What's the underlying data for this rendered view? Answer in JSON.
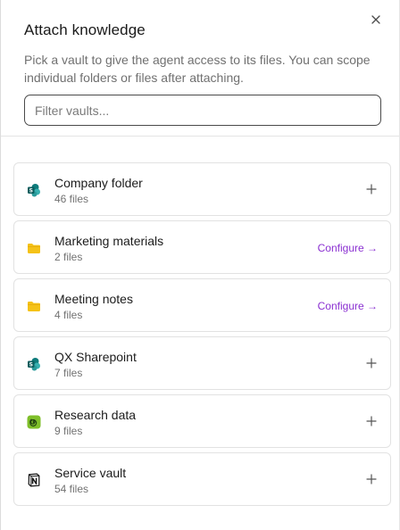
{
  "dialog": {
    "title": "Attach knowledge",
    "subtitle": "Pick a vault to give the agent access to its files. You can scope individual folders or files after attaching.",
    "filter_placeholder": "Filter vaults..."
  },
  "vaults": [
    {
      "name": "Company folder",
      "count": "46 files",
      "icon": "sharepoint-icon",
      "action": "add"
    },
    {
      "name": "Marketing materials",
      "count": "2 files",
      "icon": "folder-icon",
      "action": "configure",
      "action_label": "Configure →"
    },
    {
      "name": "Meeting notes",
      "count": "4 files",
      "icon": "folder-icon",
      "action": "configure",
      "action_label": "Configure →"
    },
    {
      "name": "QX Sharepoint",
      "count": "7 files",
      "icon": "sharepoint-icon",
      "action": "add"
    },
    {
      "name": "Research data",
      "count": "9 files",
      "icon": "spiral-icon",
      "action": "add"
    },
    {
      "name": "Service vault",
      "count": "54 files",
      "icon": "notion-icon",
      "action": "add"
    }
  ],
  "colors": {
    "accent": "#8a2fd1",
    "folder": "#f5c218",
    "sharepoint": "#0b8484",
    "spiral": "#7fbf2a"
  }
}
